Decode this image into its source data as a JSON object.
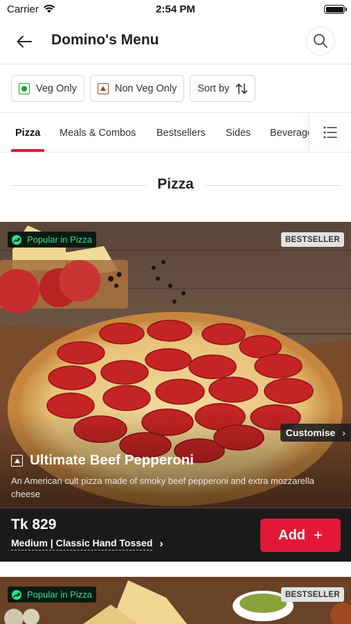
{
  "status_bar": {
    "carrier": "Carrier",
    "time": "2:54 PM"
  },
  "header": {
    "title": "Domino's Menu",
    "back_icon": "arrow-left-icon",
    "search_icon": "search-icon"
  },
  "filters": [
    {
      "label": "Veg Only",
      "icon": "veg-icon"
    },
    {
      "label": "Non Veg Only",
      "icon": "non-veg-icon"
    },
    {
      "label": "Sort by",
      "icon": "sort-icon"
    }
  ],
  "tabs": {
    "items": [
      "Pizza",
      "Meals & Combos",
      "Bestsellers",
      "Sides",
      "Beverages"
    ],
    "active": "Pizza",
    "menu_icon": "list-icon"
  },
  "section": {
    "title": "Pizza"
  },
  "products": [
    {
      "tag": "Popular in Pizza",
      "badge": "BESTSELLER",
      "customise": "Customise",
      "name": "Ultimate Beef Pepperoni",
      "description": "An American cult pizza made of smoky beef pepperoni and extra mozzarella cheese",
      "price": "Tk 829",
      "variant": "Medium | Classic Hand Tossed",
      "add_label": "Add"
    },
    {
      "tag": "Popular in Pizza",
      "badge": "BESTSELLER"
    }
  ],
  "colors": {
    "accent": "#e31837",
    "veg": "#1e9c3a",
    "non_veg": "#8a4a28",
    "popular_tag": "#2de08e"
  }
}
